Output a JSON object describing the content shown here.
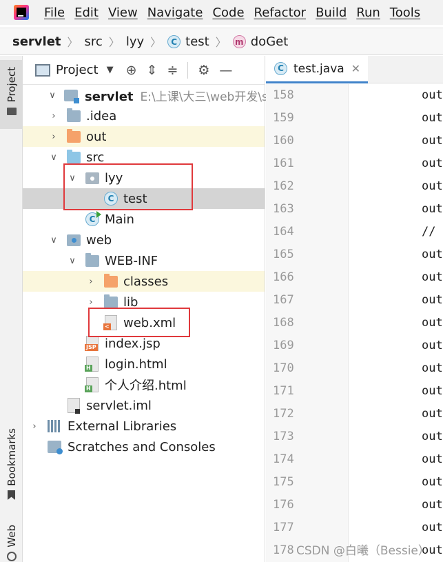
{
  "menubar": {
    "items": [
      "File",
      "Edit",
      "View",
      "Navigate",
      "Code",
      "Refactor",
      "Build",
      "Run",
      "Tools"
    ]
  },
  "breadcrumb": {
    "items": [
      "servlet",
      "src",
      "lyy",
      "test",
      "doGet"
    ],
    "icon_class": "C",
    "icon_method": "m"
  },
  "toolstrip": {
    "project": "Project",
    "bookmarks": "Bookmarks",
    "web": "Web"
  },
  "project_panel": {
    "title": "Project",
    "tree": [
      {
        "label": "servlet",
        "path": "E:\\上课\\大三\\web开发\\serv"
      },
      {
        "label": ".idea"
      },
      {
        "label": "out"
      },
      {
        "label": "src"
      },
      {
        "label": "lyy"
      },
      {
        "label": "test"
      },
      {
        "label": "Main"
      },
      {
        "label": "web"
      },
      {
        "label": "WEB-INF"
      },
      {
        "label": "classes"
      },
      {
        "label": "lib"
      },
      {
        "label": "web.xml"
      },
      {
        "label": "index.jsp"
      },
      {
        "label": "login.html"
      },
      {
        "label": "个人介绍.html"
      },
      {
        "label": "servlet.iml"
      },
      {
        "label": "External Libraries"
      },
      {
        "label": "Scratches and Consoles"
      }
    ],
    "file_tags": {
      "jsp": "JSP",
      "html": "H",
      "xml": "<"
    }
  },
  "editor": {
    "tab": "test.java",
    "lines": [
      {
        "n": "158",
        "code": "out"
      },
      {
        "n": "159",
        "code": "out"
      },
      {
        "n": "160",
        "code": "out"
      },
      {
        "n": "161",
        "code": "out"
      },
      {
        "n": "162",
        "code": "out"
      },
      {
        "n": "163",
        "code": "out"
      },
      {
        "n": "164",
        "code": "//"
      },
      {
        "n": "165",
        "code": "out"
      },
      {
        "n": "166",
        "code": "out"
      },
      {
        "n": "167",
        "code": "out"
      },
      {
        "n": "168",
        "code": "out"
      },
      {
        "n": "169",
        "code": "out"
      },
      {
        "n": "170",
        "code": "out"
      },
      {
        "n": "171",
        "code": "out"
      },
      {
        "n": "172",
        "code": "out"
      },
      {
        "n": "173",
        "code": "out"
      },
      {
        "n": "174",
        "code": "out"
      },
      {
        "n": "175",
        "code": "out"
      },
      {
        "n": "176",
        "code": "out"
      },
      {
        "n": "177",
        "code": "out"
      },
      {
        "n": "178",
        "code": "out"
      }
    ]
  },
  "watermark": "CSDN @白曦（Bessie）"
}
